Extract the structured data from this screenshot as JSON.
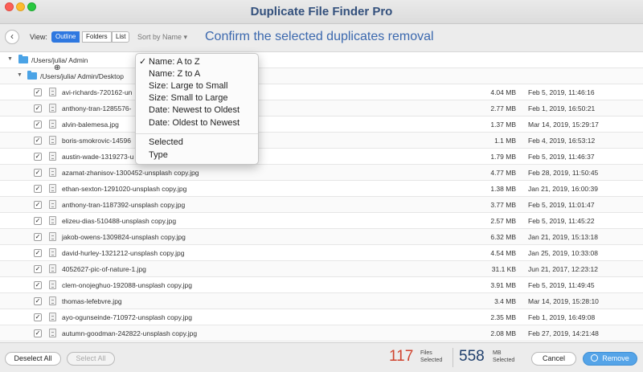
{
  "window": {
    "title": "Duplicate File Finder Pro"
  },
  "toolbar": {
    "view_label": "View:",
    "view_modes": [
      "Outline",
      "Folders",
      "List"
    ],
    "sort_label": "Sort by Name",
    "headline": "Confirm the selected duplicates removal"
  },
  "tree": {
    "root_folder": "/Users/julia/ Admin",
    "sub_folder": "/Users/julia/ Admin/Desktop"
  },
  "files": [
    {
      "name": "avi-richards-720162-un",
      "size": "4.04 MB",
      "date": "Feb 5, 2019, 11:46:16",
      "checked": true
    },
    {
      "name": "anthony-tran-1285576-",
      "size": "2.77 MB",
      "date": "Feb 1, 2019, 16:50:21",
      "checked": true
    },
    {
      "name": "alvin-balemesa.jpg",
      "size": "1.37 MB",
      "date": "Mar 14, 2019, 15:29:17",
      "checked": true
    },
    {
      "name": "boris-smokrovic-14596",
      "size": "1.1 MB",
      "date": "Feb 4, 2019, 16:53:12",
      "checked": true
    },
    {
      "name": "austin-wade-1319273-u",
      "size": "1.79 MB",
      "date": "Feb 5, 2019, 11:46:37",
      "checked": true
    },
    {
      "name": "azamat-zhanisov-1300452-unsplash copy.jpg",
      "size": "4.77 MB",
      "date": "Feb 28, 2019, 11:50:45",
      "checked": true
    },
    {
      "name": "ethan-sexton-1291020-unsplash copy.jpg",
      "size": "1.38 MB",
      "date": "Jan 21, 2019, 16:00:39",
      "checked": true
    },
    {
      "name": "anthony-tran-1187392-unsplash copy.jpg",
      "size": "3.77 MB",
      "date": "Feb 5, 2019, 11:01:47",
      "checked": true
    },
    {
      "name": "elizeu-dias-510488-unsplash copy.jpg",
      "size": "2.57 MB",
      "date": "Feb 5, 2019, 11:45:22",
      "checked": true
    },
    {
      "name": "jakob-owens-1309824-unsplash copy.jpg",
      "size": "6.32 MB",
      "date": "Jan 21, 2019, 15:13:18",
      "checked": true
    },
    {
      "name": "david-hurley-1321212-unsplash copy.jpg",
      "size": "4.54 MB",
      "date": "Jan 25, 2019, 10:33:08",
      "checked": true
    },
    {
      "name": "4052627-pic-of-nature-1.jpg",
      "size": "31.1 KB",
      "date": "Jun 21, 2017, 12:23:12",
      "checked": true
    },
    {
      "name": "clem-onojeghuo-192088-unsplash copy.jpg",
      "size": "3.91 MB",
      "date": "Feb 5, 2019, 11:49:45",
      "checked": true
    },
    {
      "name": "thomas-lefebvre.jpg",
      "size": "3.4 MB",
      "date": "Mar 14, 2019, 15:28:10",
      "checked": true
    },
    {
      "name": "ayo-ogunseinde-710972-unsplash copy.jpg",
      "size": "2.35 MB",
      "date": "Feb 1, 2019, 16:49:08",
      "checked": true
    },
    {
      "name": "autumn-goodman-242822-unsplash copy.jpg",
      "size": "2.08 MB",
      "date": "Feb 27, 2019, 14:21:48",
      "checked": true
    }
  ],
  "sort_menu": {
    "items": [
      "Name: A to Z",
      "Name: Z to A",
      "Size: Large to Small",
      "Size: Small to Large",
      "Date: Newest to Oldest",
      "Date: Oldest to Newest"
    ],
    "extra_items": [
      "Selected",
      "Type"
    ],
    "selected_index": 0,
    "checkmark": "✓"
  },
  "footer": {
    "deselect_all": "Deselect All",
    "select_all": "Select All",
    "files_count": "117",
    "files_label_1": "Files",
    "files_label_2": "Selected",
    "mb_count": "558",
    "mb_label_1": "MB",
    "mb_label_2": "Selected",
    "cancel": "Cancel",
    "remove": "Remove"
  },
  "colors": {
    "accent": "#2f78e0",
    "headline": "#3b68ae",
    "files_count": "#d0442f",
    "remove_button": "#55a4e8"
  },
  "icons": {
    "back": "chevron-left-icon",
    "folder": "folder-icon",
    "file": "file-icon",
    "checkbox": "checkbox-checked-icon",
    "trash": "trash-icon",
    "magnifier": "magnifier-cursor-icon"
  }
}
